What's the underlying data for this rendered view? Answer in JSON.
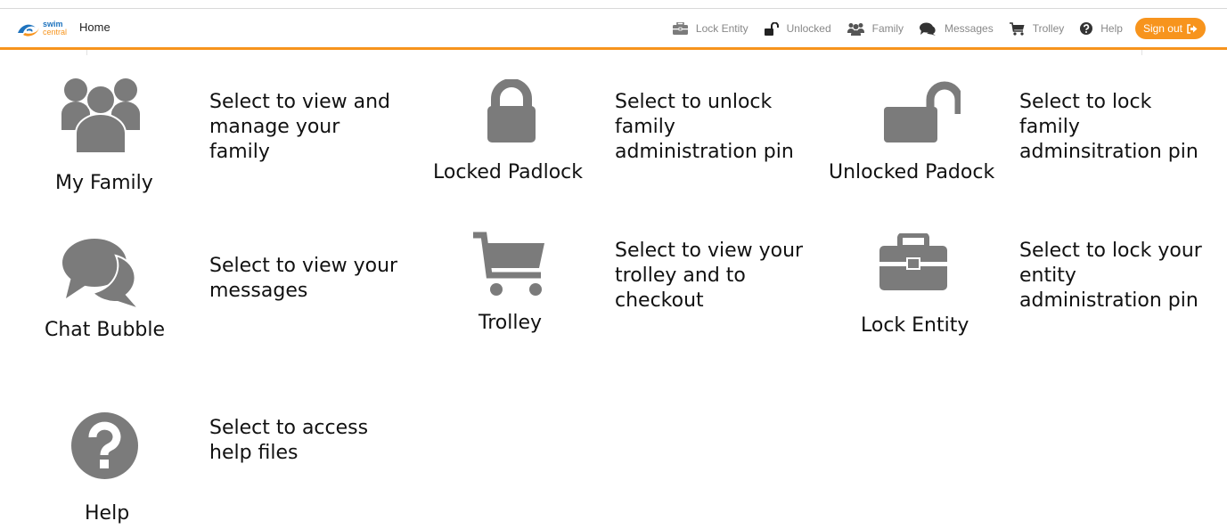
{
  "navbar": {
    "brand_top": "swim",
    "brand_bottom": "central",
    "home_label": "Home",
    "items": [
      {
        "label": "Lock Entity",
        "icon": "briefcase-icon"
      },
      {
        "label": "Unlocked",
        "icon": "unlock-icon"
      },
      {
        "label": "Family",
        "icon": "users-icon"
      },
      {
        "label": "Messages",
        "icon": "comments-icon"
      },
      {
        "label": "Trolley",
        "icon": "cart-icon"
      },
      {
        "label": "Help",
        "icon": "help-icon"
      }
    ],
    "signout_label": "Sign out",
    "accent_color": "#f7941d"
  },
  "legend": {
    "icon_color": "#7b7b7b",
    "entries": [
      {
        "icon": "users-icon",
        "caption": "My Family",
        "description": "Select to view and\nmanage your\nfamily"
      },
      {
        "icon": "lock-icon",
        "caption": "Locked Padlock",
        "description": "Select to unlock\nfamily\nadministration pin"
      },
      {
        "icon": "unlock-icon",
        "caption": "Unlocked Padock",
        "description": "Select to lock\nfamily\nadminsitration pin"
      },
      {
        "icon": "comments-icon",
        "caption": "Chat Bubble",
        "description": "Select to view your\nmessages"
      },
      {
        "icon": "cart-icon",
        "caption": "Trolley",
        "description": "Select to view your\ntrolley and to\ncheckout"
      },
      {
        "icon": "briefcase-icon",
        "caption": "Lock Entity",
        "description": "Select to lock your\nentity\nadministration pin"
      },
      {
        "icon": "help-icon",
        "caption": "Help",
        "description": "Select to access\nhelp files"
      }
    ]
  }
}
